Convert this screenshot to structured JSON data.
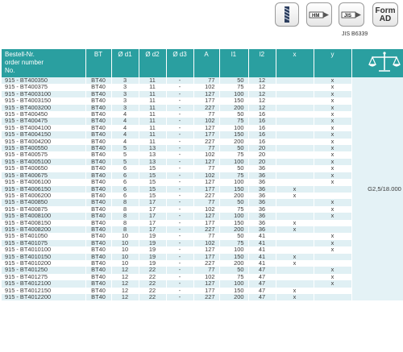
{
  "icons": [
    "drill-bit-icon",
    "hm-carbide-icon",
    "jis-standard-icon",
    "form-ad-icon"
  ],
  "icon_labels": {
    "hm": "HM",
    "jis": "JIS",
    "form_line1": "Form",
    "form_line2": "AD",
    "jis_caption": "JIS B6339"
  },
  "table": {
    "headers": {
      "art_line1": "Bestell-Nr.",
      "art_line2": "order number",
      "art_line3": "No.",
      "bt": "BT",
      "d1": "Ø d1",
      "d2": "Ø d2",
      "d3": "Ø d3",
      "a": "A",
      "l1": "l1",
      "l2": "l2",
      "x": "x",
      "y": "y",
      "price": ""
    },
    "price_note": "G2,5/18.000",
    "rows": [
      {
        "art": "915 - BT400350",
        "bt": "BT40",
        "d1": "3",
        "d2": "11",
        "d3": "-",
        "a": "77",
        "l1": "50",
        "l2": "12",
        "x": "",
        "y": "x"
      },
      {
        "art": "915 - BT400375",
        "bt": "BT40",
        "d1": "3",
        "d2": "11",
        "d3": "-",
        "a": "102",
        "l1": "75",
        "l2": "12",
        "x": "",
        "y": "x"
      },
      {
        "art": "915 - BT4003100",
        "bt": "BT40",
        "d1": "3",
        "d2": "11",
        "d3": "-",
        "a": "127",
        "l1": "100",
        "l2": "12",
        "x": "",
        "y": "x"
      },
      {
        "art": "915 - BT4003150",
        "bt": "BT40",
        "d1": "3",
        "d2": "11",
        "d3": "-",
        "a": "177",
        "l1": "150",
        "l2": "12",
        "x": "",
        "y": "x"
      },
      {
        "art": "915 - BT4003200",
        "bt": "BT40",
        "d1": "3",
        "d2": "11",
        "d3": "-",
        "a": "227",
        "l1": "200",
        "l2": "12",
        "x": "",
        "y": "x"
      },
      {
        "art": "915 - BT400450",
        "bt": "BT40",
        "d1": "4",
        "d2": "11",
        "d3": "-",
        "a": "77",
        "l1": "50",
        "l2": "16",
        "x": "",
        "y": "x"
      },
      {
        "art": "915 - BT400475",
        "bt": "BT40",
        "d1": "4",
        "d2": "11",
        "d3": "-",
        "a": "102",
        "l1": "75",
        "l2": "16",
        "x": "",
        "y": "x"
      },
      {
        "art": "915 - BT4004100",
        "bt": "BT40",
        "d1": "4",
        "d2": "11",
        "d3": "-",
        "a": "127",
        "l1": "100",
        "l2": "16",
        "x": "",
        "y": "x"
      },
      {
        "art": "915 - BT4004150",
        "bt": "BT40",
        "d1": "4",
        "d2": "11",
        "d3": "-",
        "a": "177",
        "l1": "150",
        "l2": "16",
        "x": "",
        "y": "x"
      },
      {
        "art": "915 - BT4004200",
        "bt": "BT40",
        "d1": "4",
        "d2": "11",
        "d3": "-",
        "a": "227",
        "l1": "200",
        "l2": "16",
        "x": "",
        "y": "x"
      },
      {
        "art": "915 - BT400550",
        "bt": "BT40",
        "d1": "5",
        "d2": "13",
        "d3": "-",
        "a": "77",
        "l1": "50",
        "l2": "20",
        "x": "",
        "y": "x"
      },
      {
        "art": "915 - BT400575",
        "bt": "BT40",
        "d1": "5",
        "d2": "13",
        "d3": "-",
        "a": "102",
        "l1": "75",
        "l2": "20",
        "x": "",
        "y": "x"
      },
      {
        "art": "915 - BT4005100",
        "bt": "BT40",
        "d1": "5",
        "d2": "13",
        "d3": "-",
        "a": "127",
        "l1": "100",
        "l2": "20",
        "x": "",
        "y": "x"
      },
      {
        "art": "915 - BT400650",
        "bt": "BT40",
        "d1": "6",
        "d2": "15",
        "d3": "-",
        "a": "77",
        "l1": "50",
        "l2": "36",
        "x": "",
        "y": "x"
      },
      {
        "art": "915 - BT400675",
        "bt": "BT40",
        "d1": "6",
        "d2": "15",
        "d3": "-",
        "a": "102",
        "l1": "75",
        "l2": "36",
        "x": "",
        "y": "x"
      },
      {
        "art": "915 - BT4006100",
        "bt": "BT40",
        "d1": "6",
        "d2": "15",
        "d3": "-",
        "a": "127",
        "l1": "100",
        "l2": "36",
        "x": "",
        "y": "x"
      },
      {
        "art": "915 - BT4006150",
        "bt": "BT40",
        "d1": "6",
        "d2": "15",
        "d3": "-",
        "a": "177",
        "l1": "150",
        "l2": "36",
        "x": "x",
        "y": ""
      },
      {
        "art": "915 - BT4006200",
        "bt": "BT40",
        "d1": "6",
        "d2": "15",
        "d3": "-",
        "a": "227",
        "l1": "200",
        "l2": "36",
        "x": "x",
        "y": ""
      },
      {
        "art": "915 - BT400850",
        "bt": "BT40",
        "d1": "8",
        "d2": "17",
        "d3": "-",
        "a": "77",
        "l1": "50",
        "l2": "36",
        "x": "",
        "y": "x"
      },
      {
        "art": "915 - BT400875",
        "bt": "BT40",
        "d1": "8",
        "d2": "17",
        "d3": "-",
        "a": "102",
        "l1": "75",
        "l2": "36",
        "x": "",
        "y": "x"
      },
      {
        "art": "915 - BT4008100",
        "bt": "BT40",
        "d1": "8",
        "d2": "17",
        "d3": "-",
        "a": "127",
        "l1": "100",
        "l2": "36",
        "x": "",
        "y": "x"
      },
      {
        "art": "915 - BT4008150",
        "bt": "BT40",
        "d1": "8",
        "d2": "17",
        "d3": "-",
        "a": "177",
        "l1": "150",
        "l2": "36",
        "x": "x",
        "y": ""
      },
      {
        "art": "915 - BT4008200",
        "bt": "BT40",
        "d1": "8",
        "d2": "17",
        "d3": "-",
        "a": "227",
        "l1": "200",
        "l2": "36",
        "x": "x",
        "y": ""
      },
      {
        "art": "915 - BT401050",
        "bt": "BT40",
        "d1": "10",
        "d2": "19",
        "d3": "-",
        "a": "77",
        "l1": "50",
        "l2": "41",
        "x": "",
        "y": "x"
      },
      {
        "art": "915 - BT401075",
        "bt": "BT40",
        "d1": "10",
        "d2": "19",
        "d3": "-",
        "a": "102",
        "l1": "75",
        "l2": "41",
        "x": "",
        "y": "x"
      },
      {
        "art": "915 - BT4010100",
        "bt": "BT40",
        "d1": "10",
        "d2": "19",
        "d3": "-",
        "a": "127",
        "l1": "100",
        "l2": "41",
        "x": "",
        "y": "x"
      },
      {
        "art": "915 - BT4010150",
        "bt": "BT40",
        "d1": "10",
        "d2": "19",
        "d3": "-",
        "a": "177",
        "l1": "150",
        "l2": "41",
        "x": "x",
        "y": ""
      },
      {
        "art": "915 - BT4010200",
        "bt": "BT40",
        "d1": "10",
        "d2": "19",
        "d3": "-",
        "a": "227",
        "l1": "200",
        "l2": "41",
        "x": "x",
        "y": ""
      },
      {
        "art": "915 - BT401250",
        "bt": "BT40",
        "d1": "12",
        "d2": "22",
        "d3": "-",
        "a": "77",
        "l1": "50",
        "l2": "47",
        "x": "",
        "y": "x"
      },
      {
        "art": "915 - BT401275",
        "bt": "BT40",
        "d1": "12",
        "d2": "22",
        "d3": "-",
        "a": "102",
        "l1": "75",
        "l2": "47",
        "x": "",
        "y": "x"
      },
      {
        "art": "915 - BT4012100",
        "bt": "BT40",
        "d1": "12",
        "d2": "22",
        "d3": "-",
        "a": "127",
        "l1": "100",
        "l2": "47",
        "x": "",
        "y": "x"
      },
      {
        "art": "915 - BT4012150",
        "bt": "BT40",
        "d1": "12",
        "d2": "22",
        "d3": "-",
        "a": "177",
        "l1": "150",
        "l2": "47",
        "x": "x",
        "y": ""
      },
      {
        "art": "915 - BT4012200",
        "bt": "BT40",
        "d1": "12",
        "d2": "22",
        "d3": "-",
        "a": "227",
        "l1": "200",
        "l2": "47",
        "x": "x",
        "y": ""
      }
    ]
  }
}
